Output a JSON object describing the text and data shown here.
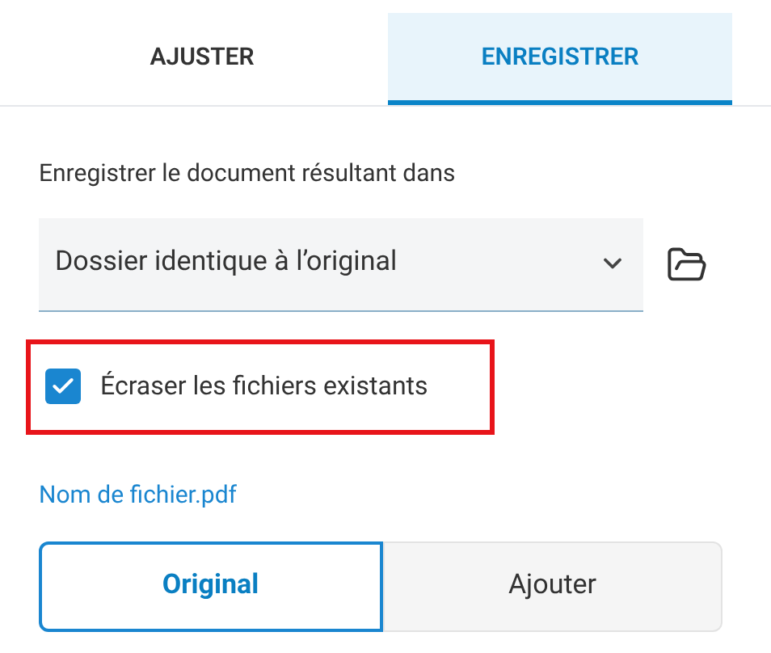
{
  "tabs": [
    {
      "label": "AJUSTER",
      "selected": false
    },
    {
      "label": "ENREGISTRER",
      "selected": true
    }
  ],
  "destination": {
    "label": "Enregistrer le document résultant dans",
    "value": "Dossier identique à l’original"
  },
  "overwrite": {
    "label": "Écraser les fichiers existants",
    "checked": true,
    "highlighted": true
  },
  "file_name_link": "Nom de fichier.pdf",
  "mode_options": [
    {
      "label": "Original",
      "selected": true
    },
    {
      "label": "Ajouter",
      "selected": false
    }
  ]
}
